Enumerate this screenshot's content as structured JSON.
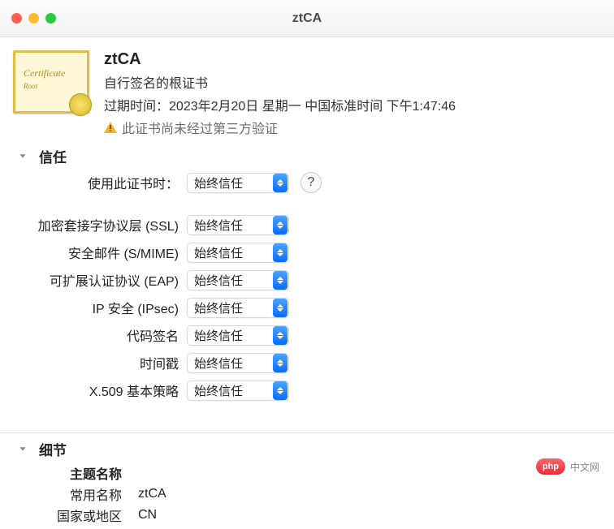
{
  "window": {
    "title": "ztCA"
  },
  "certificate": {
    "name": "ztCA",
    "subtitle": "自行签名的根证书",
    "expiry_prefix": "过期时间：",
    "expiry_value": "2023年2月20日 星期一 中国标准时间 下午1:47:46",
    "warning": "此证书尚未经过第三方验证",
    "icon": {
      "line1": "Certificate",
      "line2": "Root"
    }
  },
  "sections": {
    "trust": "信任",
    "details": "细节"
  },
  "trust": {
    "use_label": "使用此证书时：",
    "help_tooltip": "?",
    "option_always": "始终信任",
    "policies": [
      {
        "label": "加密套接字协议层 (SSL)",
        "value": "始终信任"
      },
      {
        "label": "安全邮件 (S/MIME)",
        "value": "始终信任"
      },
      {
        "label": "可扩展认证协议 (EAP)",
        "value": "始终信任"
      },
      {
        "label": "IP 安全 (IPsec)",
        "value": "始终信任"
      },
      {
        "label": "代码签名",
        "value": "始终信任"
      },
      {
        "label": "时间戳",
        "value": "始终信任"
      },
      {
        "label": "X.509 基本策略",
        "value": "始终信任"
      }
    ]
  },
  "details": {
    "subject_name_label": "主题名称",
    "rows": [
      {
        "label": "常用名称",
        "value": "ztCA"
      },
      {
        "label": "国家或地区",
        "value": "CN"
      }
    ]
  },
  "watermark": {
    "badge": "php",
    "text": "中文网"
  }
}
